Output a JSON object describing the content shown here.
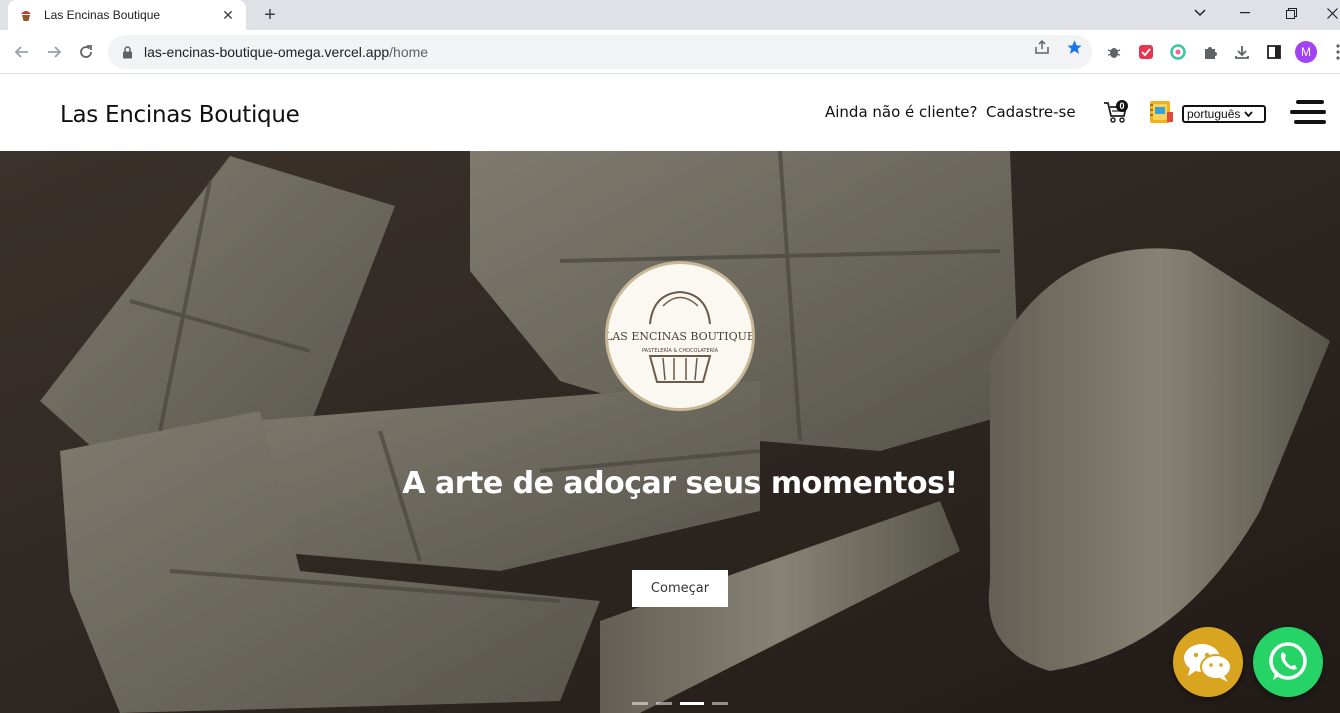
{
  "browser": {
    "tab_title": "Las Encinas Boutique",
    "url_host": "las-encinas-boutique-omega.vercel.app",
    "url_path": "/home",
    "profile_initial": "M"
  },
  "header": {
    "brand": "Las Encinas Boutique",
    "not_client": "Ainda não é cliente?",
    "signup": "Cadastre-se",
    "cart_count": "0",
    "language": "português"
  },
  "hero": {
    "logo_text": "LAS ENCINAS BOUTIQUE",
    "logo_subtext": "PASTELERÍA & CHOCOLATERÍA",
    "title": "A arte de adoçar seus momentos!",
    "cta": "Começar",
    "slide_count": 4,
    "active_slide": 3
  },
  "colors": {
    "wechat": "#d9a521",
    "whatsapp": "#25d366",
    "accent_star": "#1a73e8"
  }
}
